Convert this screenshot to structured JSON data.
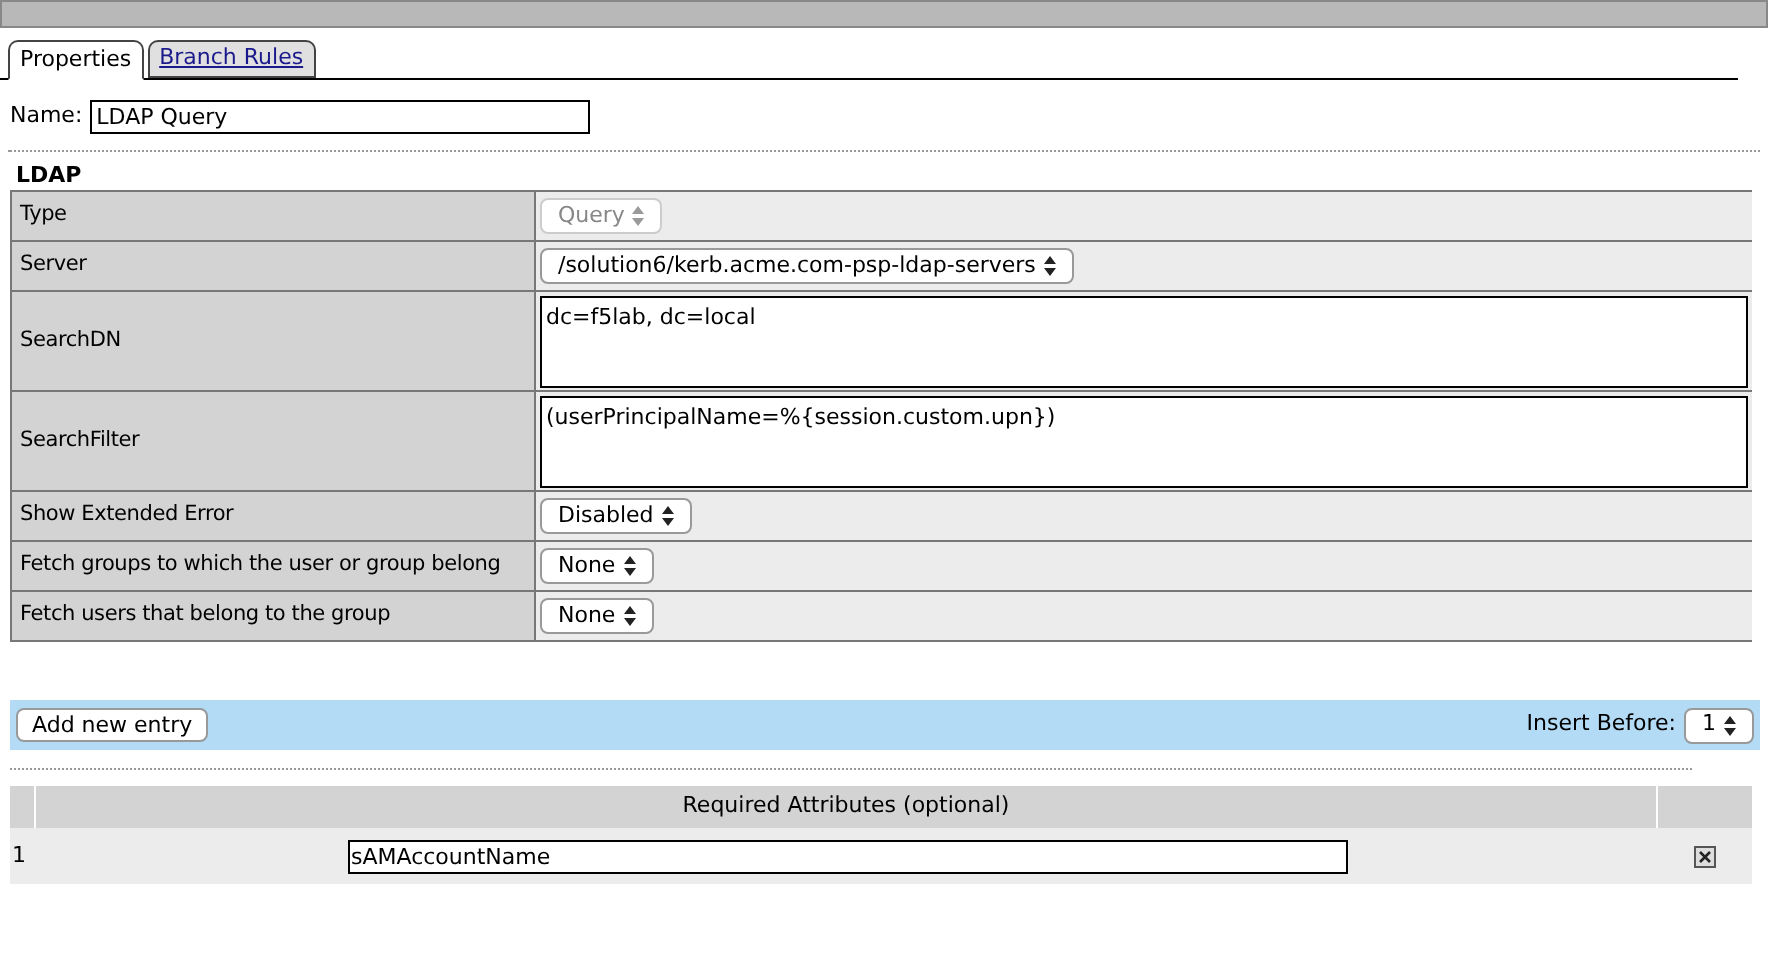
{
  "tabs": [
    {
      "label": "Properties",
      "selected": true,
      "kind": "tab"
    },
    {
      "label": "Branch Rules",
      "selected": false,
      "kind": "link"
    }
  ],
  "name_field": {
    "label": "Name:",
    "value": "LDAP Query"
  },
  "section_title": "LDAP",
  "properties": [
    {
      "label": "Type",
      "kind": "select",
      "value": "Query",
      "disabled": true
    },
    {
      "label": "Server",
      "kind": "select",
      "value": "/solution6/kerb.acme.com-psp-ldap-servers",
      "disabled": false
    },
    {
      "label": "SearchDN",
      "kind": "textarea",
      "value": "dc=f5lab, dc=local"
    },
    {
      "label": "SearchFilter",
      "kind": "textarea",
      "value": "(userPrincipalName=%{session.custom.upn})"
    },
    {
      "label": "Show Extended Error",
      "kind": "select",
      "value": "Disabled",
      "disabled": false
    },
    {
      "label": "Fetch groups to which the user or group belong",
      "kind": "select",
      "value": "None",
      "disabled": false
    },
    {
      "label": "Fetch users that belong to the group",
      "kind": "select",
      "value": "None",
      "disabled": false
    }
  ],
  "toolbar": {
    "add_button": "Add new entry",
    "insert_label": "Insert Before:",
    "insert_value": "1"
  },
  "attributes_table": {
    "column_header": "Required Attributes (optional)",
    "rows": [
      {
        "index": "1",
        "value": "sAMAccountName"
      }
    ]
  }
}
